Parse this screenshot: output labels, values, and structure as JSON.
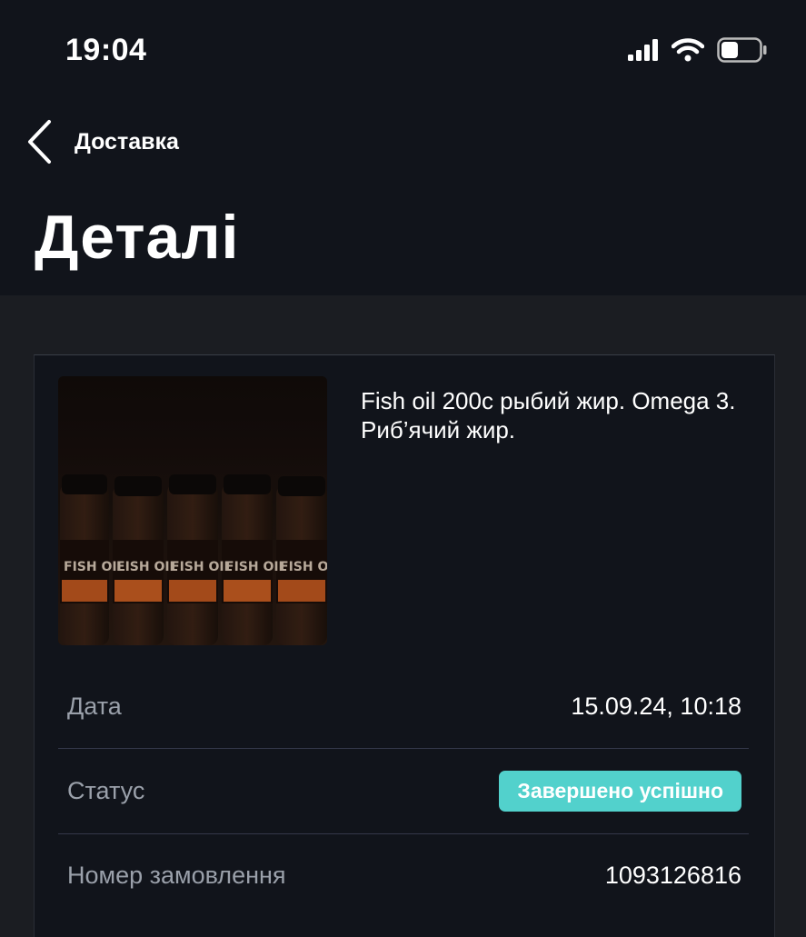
{
  "status_bar": {
    "time": "19:04",
    "icons": [
      "signal-icon",
      "wifi-icon",
      "battery-icon"
    ]
  },
  "nav": {
    "back_label": "Доставка",
    "title": "Деталі"
  },
  "product": {
    "title": "Fish oil 200c рыбий жир. Omega 3. Риб’ячий жир.",
    "image_label": "FISH OIL"
  },
  "details": [
    {
      "label": "Дата",
      "value": "15.09.24, 10:18"
    },
    {
      "label": "Статус",
      "value": "Завершено успішно"
    },
    {
      "label": "Номер замовлення",
      "value": "1093126816"
    }
  ],
  "colors": {
    "header_bg": "#11141b",
    "page_bg": "#1b1d22",
    "status_badge": "#52d1cc"
  }
}
